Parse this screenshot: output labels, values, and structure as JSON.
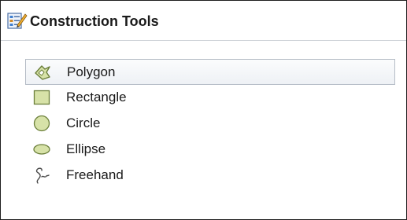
{
  "panel": {
    "title": "Construction Tools",
    "title_icon": "construction-tools-icon"
  },
  "tools": [
    {
      "label": "Polygon",
      "icon": "polygon-icon",
      "selected": true
    },
    {
      "label": "Rectangle",
      "icon": "rectangle-icon",
      "selected": false
    },
    {
      "label": "Circle",
      "icon": "circle-icon",
      "selected": false
    },
    {
      "label": "Ellipse",
      "icon": "ellipse-icon",
      "selected": false
    },
    {
      "label": "Freehand",
      "icon": "freehand-icon",
      "selected": false
    }
  ],
  "colors": {
    "shape_fill": "#d7e2a8",
    "shape_stroke": "#6b7f3a",
    "selection_border": "#b5bcc6"
  }
}
